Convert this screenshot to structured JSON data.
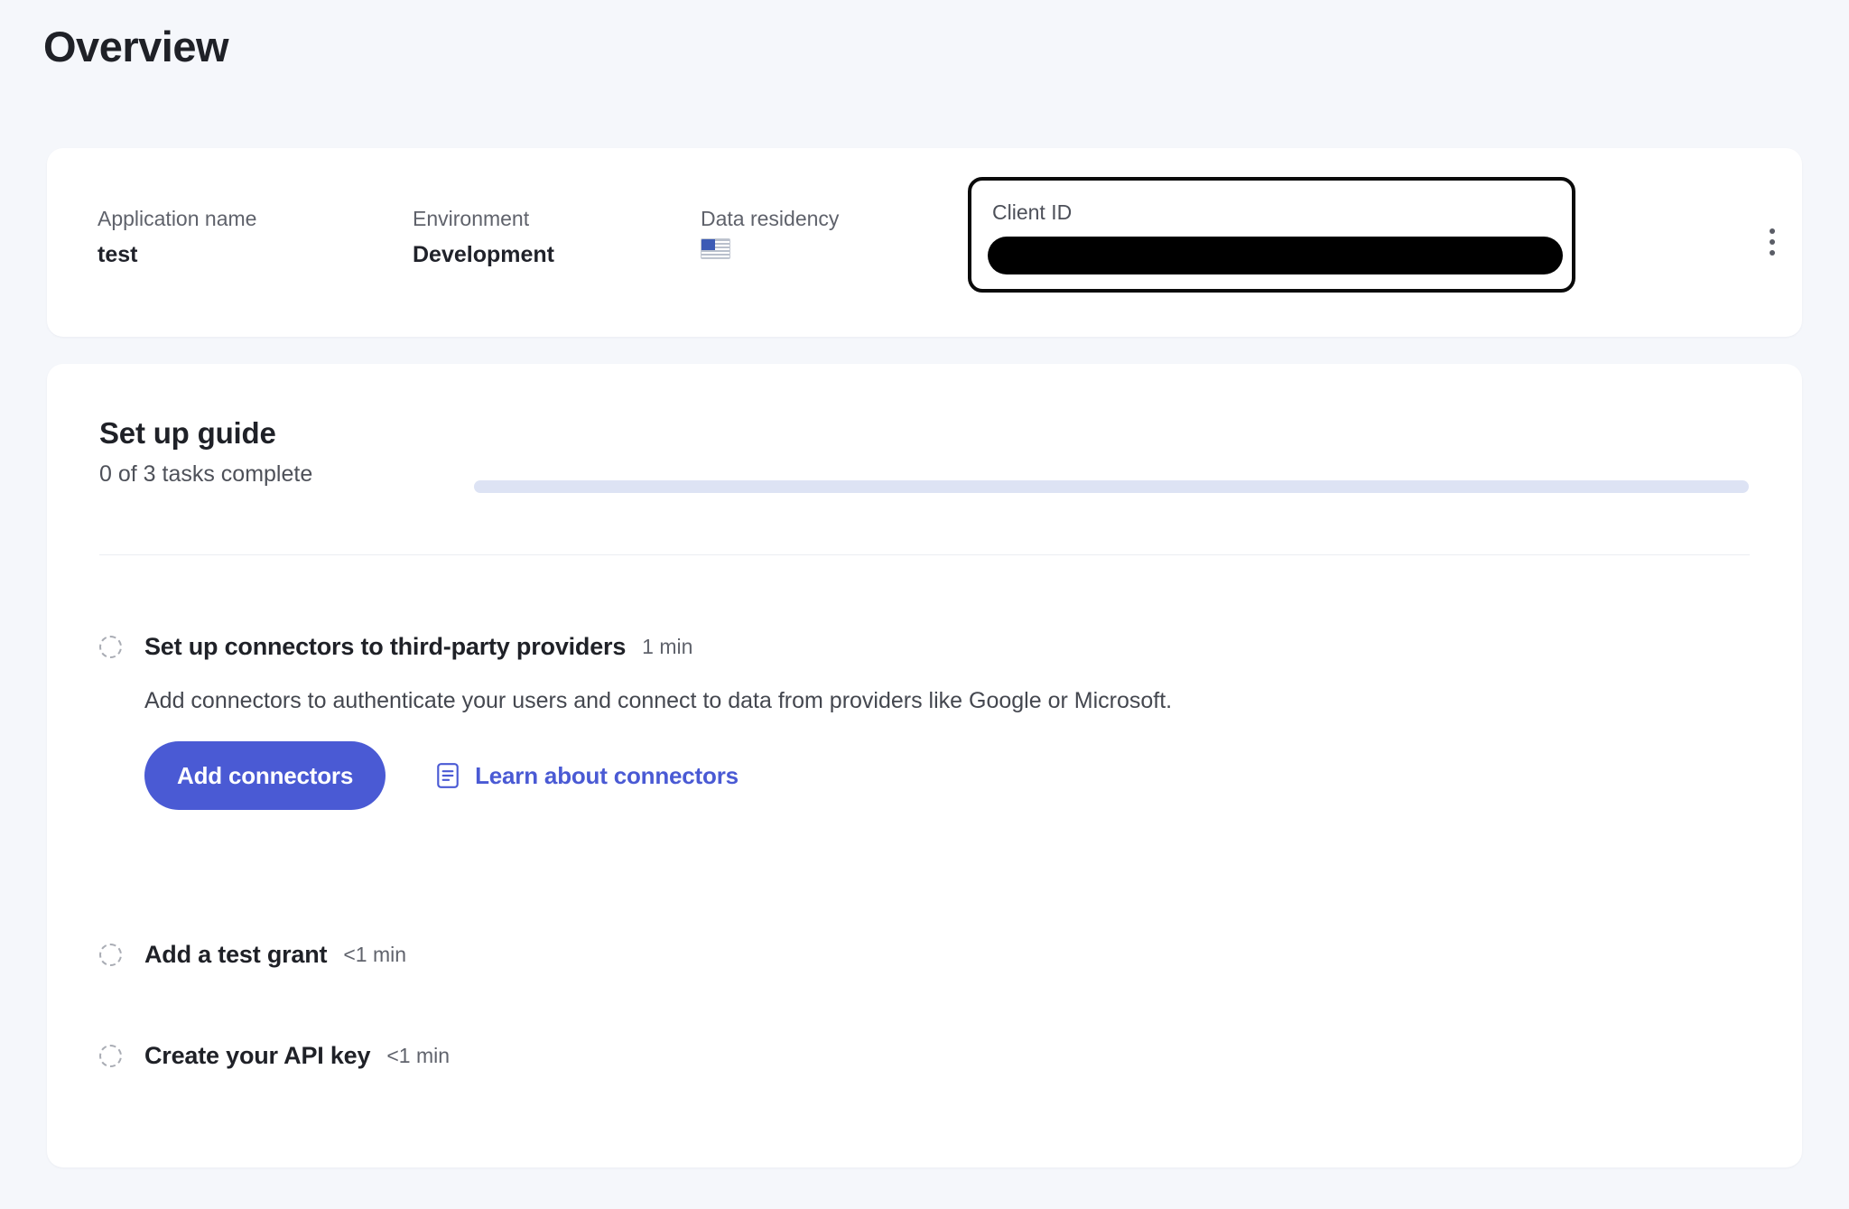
{
  "page": {
    "title": "Overview",
    "background_color": "#f5f7fb",
    "accent_color": "#4a5ad4"
  },
  "info_card": {
    "fields": [
      {
        "label": "Application name",
        "value": "test"
      },
      {
        "label": "Environment",
        "value": "Development"
      },
      {
        "label": "Data residency",
        "value": "🇺🇸"
      }
    ],
    "client_id": {
      "label": "Client ID",
      "value": "",
      "redacted": true,
      "focused": true
    },
    "menu_icon": "kebab-menu-icon"
  },
  "setup_guide": {
    "title": "Set up guide",
    "progress_text": "0 of 3 tasks complete",
    "completed_count": 0,
    "total_count": 3,
    "progress_percent": 0,
    "track_color": "#dde3f4",
    "tasks": [
      {
        "name": "Set up connectors to third-party providers",
        "duration": "1 min",
        "complete": false,
        "description": "Add connectors to authenticate your users and connect to data from providers like Google or Microsoft.",
        "primary_action": "Add connectors",
        "link_label": "Learn about connectors",
        "link_icon": "document-icon"
      },
      {
        "name": "Add a test grant",
        "duration": "<1 min",
        "complete": false
      },
      {
        "name": "Create your API key",
        "duration": "<1 min",
        "complete": false
      }
    ]
  }
}
